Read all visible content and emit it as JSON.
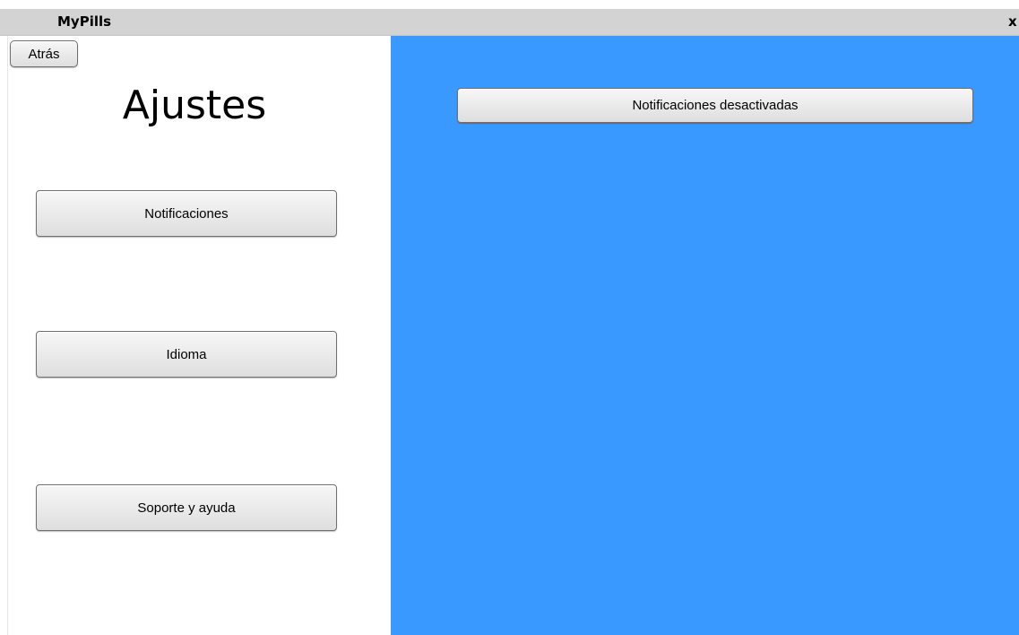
{
  "window": {
    "title": "MyPills",
    "close_label": "x"
  },
  "left_panel": {
    "back_label": "Atrás",
    "title": "Ajustes",
    "menu": {
      "notifications_label": "Notificaciones",
      "language_label": "Idioma",
      "support_label": "Soporte y ayuda"
    }
  },
  "right_panel": {
    "background_color": "#3a99ff",
    "notifications_toggle_label": "Notificaciones desactivadas"
  }
}
